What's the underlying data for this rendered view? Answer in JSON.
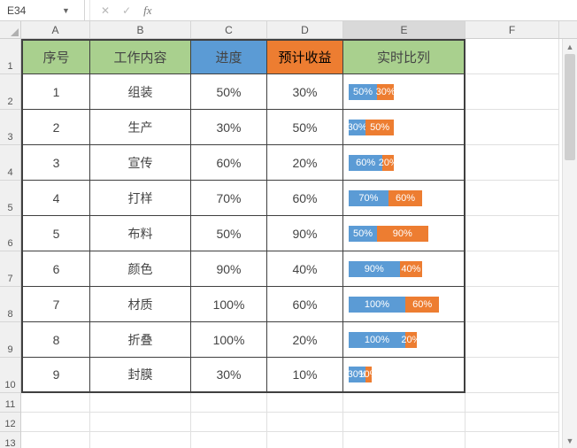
{
  "formulaBar": {
    "cellRef": "E34",
    "value": ""
  },
  "columns": [
    "A",
    "B",
    "C",
    "D",
    "E",
    "F"
  ],
  "colWidths": {
    "A": 78,
    "B": 114,
    "C": 86,
    "D": 86,
    "E": 138,
    "F": 106
  },
  "selectedColumn": "E",
  "rowNumbers": [
    1,
    2,
    3,
    4,
    5,
    6,
    7,
    8,
    9,
    10,
    11,
    12,
    13
  ],
  "headers": {
    "A": "序号",
    "B": "工作内容",
    "C": "进度",
    "D": "预计收益",
    "E": "实时比列"
  },
  "rows": [
    {
      "no": "1",
      "task": "组装",
      "progress": "50%",
      "revenue": "30%",
      "p": 50,
      "r": 30
    },
    {
      "no": "2",
      "task": "生产",
      "progress": "30%",
      "revenue": "50%",
      "p": 30,
      "r": 50
    },
    {
      "no": "3",
      "task": "宣传",
      "progress": "60%",
      "revenue": "20%",
      "p": 60,
      "r": 20
    },
    {
      "no": "4",
      "task": "打样",
      "progress": "70%",
      "revenue": "60%",
      "p": 70,
      "r": 60
    },
    {
      "no": "5",
      "task": "布料",
      "progress": "50%",
      "revenue": "90%",
      "p": 50,
      "r": 90
    },
    {
      "no": "6",
      "task": "颜色",
      "progress": "90%",
      "revenue": "40%",
      "p": 90,
      "r": 40
    },
    {
      "no": "7",
      "task": "材质",
      "progress": "100%",
      "revenue": "60%",
      "p": 100,
      "r": 60
    },
    {
      "no": "8",
      "task": "折叠",
      "progress": "100%",
      "revenue": "20%",
      "p": 100,
      "r": 20
    },
    {
      "no": "9",
      "task": "封膜",
      "progress": "30%",
      "revenue": "10%",
      "p": 30,
      "r": 10
    }
  ],
  "chart_data": {
    "type": "bar",
    "title": "实时比列",
    "categories": [
      "组装",
      "生产",
      "宣传",
      "打样",
      "布料",
      "颜色",
      "材质",
      "折叠",
      "封膜"
    ],
    "series": [
      {
        "name": "进度",
        "values": [
          50,
          30,
          60,
          70,
          50,
          90,
          100,
          100,
          30
        ],
        "color": "#5b9bd5"
      },
      {
        "name": "预计收益",
        "values": [
          30,
          50,
          20,
          60,
          90,
          40,
          60,
          20,
          10
        ],
        "color": "#ed7d31"
      }
    ],
    "unit": "%",
    "stacked": true
  },
  "icons": {
    "cancel": "✕",
    "confirm": "✓",
    "fx": "fx",
    "dropdown": "▼",
    "up": "▲",
    "down": "▼"
  }
}
